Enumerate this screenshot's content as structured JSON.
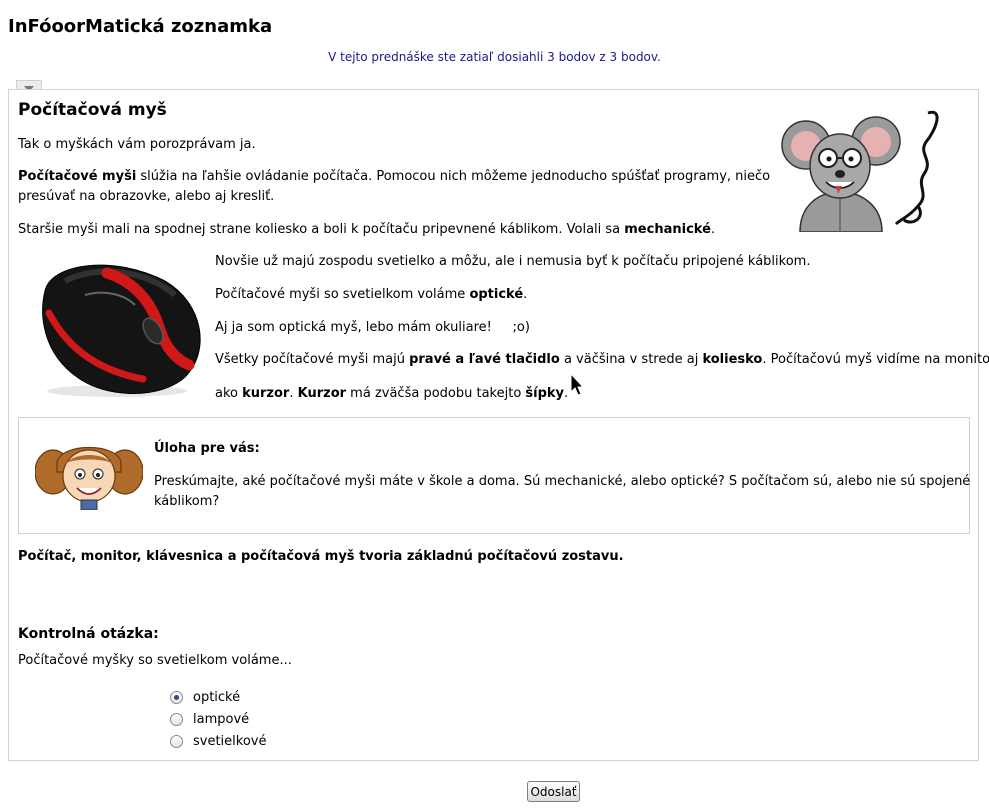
{
  "app": {
    "title": "InFóoorMatická zoznamka"
  },
  "progress": {
    "message": "V tejto prednáške ste zatiaľ dosiahli 3 bodov z 3 bodov."
  },
  "lesson": {
    "title": "Počítačová myš",
    "intro": "Tak o myškách vám porozprávam ja.",
    "p2_bold": "Počítačové myši",
    "p2_l1": " slúžia na ľahšie ovládanie počítača. Pomocou nich môžeme jednoducho spúšťať programy, niečo",
    "p2_l2": "presúvať na obrazovke, alebo aj kresliť.",
    "p3_pre": "Staršie myši mali na spodnej strane koliesko a boli k počítaču pripevnené káblikom. Volali sa ",
    "p3_bold": "mechanické",
    "p3_post": ".",
    "p4": "Novšie už majú zospodu svetielko a môžu, ale i nemusia byť k počítaču pripojené káblikom.",
    "p5_pre": "Počítačové myši so svetielkom voláme ",
    "p5_bold": "optické",
    "p5_post": ".",
    "p6": "Aj ja som optická myš, lebo mám okuliare!     ;o)",
    "p7_pre": "Všetky počítačové myši majú ",
    "p7_b1": "pravé a ľavé tlačidlo",
    "p7_mid1": " a väčšina v strede aj ",
    "p7_b2": "koliesko",
    "p7_mid2": ". Počítačovú myš vidíme na monitore v",
    "p8_pre": "ako ",
    "p8_b1": "kurzor",
    "p8_mid1": ". ",
    "p8_b2": "Kurzor",
    "p8_mid2": " má zväčša podobu takejto ",
    "p8_b3": "šípky",
    "p8_post": ".",
    "summary": "Počítač, monitor, klávesnica a počítačová myš tvoria základnú počítačovú zostavu."
  },
  "task": {
    "title": "Úloha pre vás:",
    "text_l1": "Preskúmajte, aké počítačové myši máte v škole a doma. Sú mechanické, alebo optické? S počítačom sú, alebo nie sú spojené",
    "text_l2": "káblikom?"
  },
  "quiz": {
    "title": "Kontrolná otázka:",
    "question": "Počítačové myšky so svetielkom voláme...",
    "options": [
      "optické",
      "lampové",
      "svetielkové"
    ],
    "selected_index": 0,
    "submit_label": "Odoslať"
  },
  "icons": {
    "collapse": "triangle-down-icon",
    "cartoon_mouse": "cartoon-mouse-glasses-icon",
    "computer_mouse": "computer-mouse-photo",
    "girl": "cartoon-girl-icon",
    "cursor": "arrow-cursor-icon"
  },
  "colors": {
    "link_blue": "#1a1a8c",
    "panel_border": "#d4d4d4",
    "mouse_red": "#d01818",
    "radio_checked": "#2a4b8d"
  }
}
